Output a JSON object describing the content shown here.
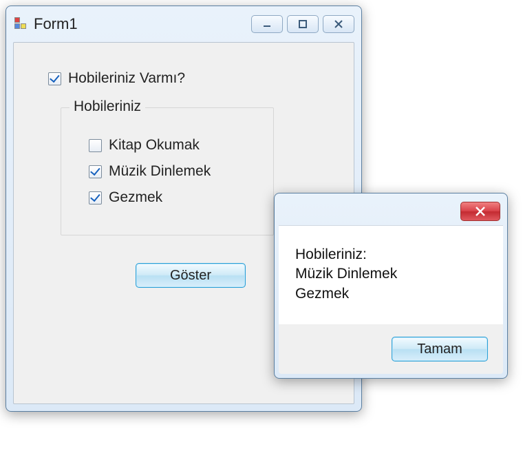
{
  "form": {
    "title": "Form1",
    "mainCheckbox": {
      "label": "Hobileriniz Varmı?",
      "checked": true
    },
    "group": {
      "legend": "Hobileriniz",
      "items": [
        {
          "label": "Kitap Okumak",
          "checked": false
        },
        {
          "label": "Müzik Dinlemek",
          "checked": true
        },
        {
          "label": "Gezmek",
          "checked": true
        }
      ]
    },
    "showButton": "Göster"
  },
  "messageBox": {
    "text": "Hobileriniz:\nMüzik Dinlemek\nGezmek",
    "okButton": "Tamam"
  }
}
